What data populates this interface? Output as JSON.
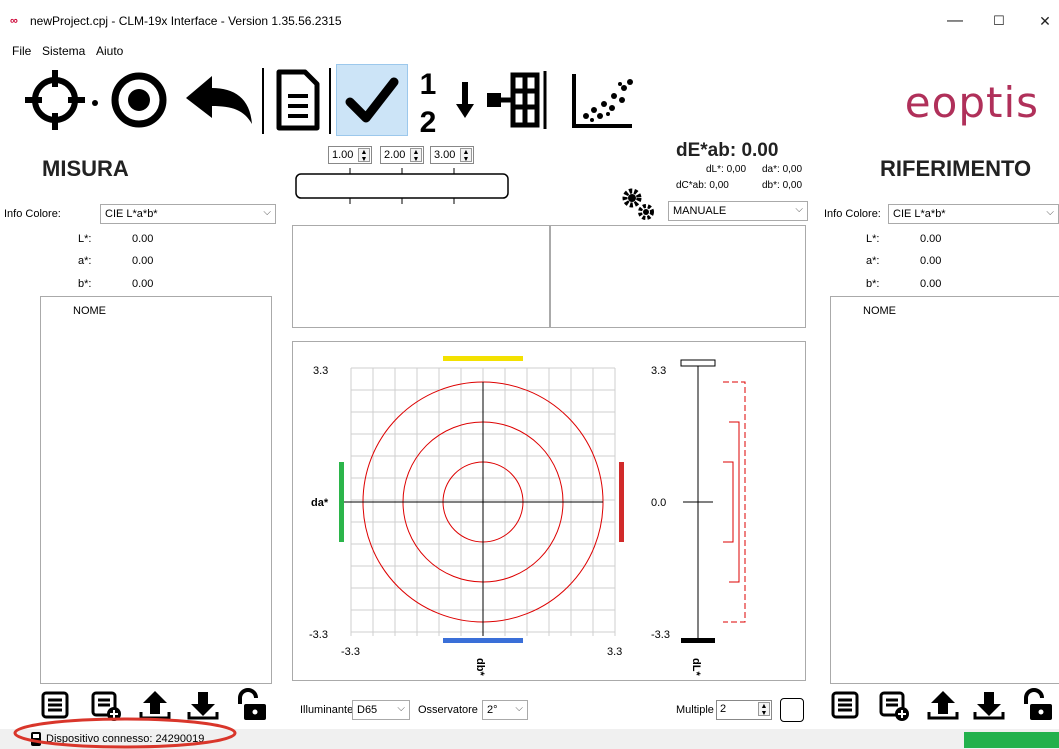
{
  "window": {
    "title": "newProject.cpj - CLM-19x Interface - Version 1.35.56.2315",
    "app_icon": "infinity-icon",
    "minimize": "—",
    "maximize": "☐",
    "close": "✕"
  },
  "menu": [
    "File",
    "Sistema",
    "Aiuto"
  ],
  "toolbar": {
    "tools": [
      "crosshair-icon",
      "target-icon",
      "undo-icon",
      "document-icon",
      "check-icon",
      "fraction-icon",
      "arrow-down-icon",
      "tree-icon",
      "scatter-icon"
    ],
    "active_tool": "check-icon"
  },
  "brand": {
    "logo": "eoptis",
    "color": "#b0305a"
  },
  "left": {
    "heading": "MISURA",
    "info_label": "Info Colore:",
    "info_value": "CIE L*a*b*",
    "L_label": "L*:",
    "L_value": "0.00",
    "a_label": "a*:",
    "a_value": "0.00",
    "b_label": "b*:",
    "b_value": "0.00",
    "list_header": "NOME"
  },
  "right": {
    "heading": "RIFERIMENTO",
    "info_label": "Info Colore:",
    "info_value": "CIE L*a*b*",
    "L_label": "L*:",
    "L_value": "0.00",
    "a_label": "a*:",
    "a_value": "0.00",
    "b_label": "b*:",
    "b_value": "0.00",
    "list_header": "NOME"
  },
  "center": {
    "spin1": "1.00",
    "spin2": "2.00",
    "spin3": "3.00",
    "dE_label": "dE*ab: 0.00",
    "dL": "dL*: 0,00",
    "da": "da*: 0,00",
    "dC": "dC*ab: 0,00",
    "db": "db*: 0,00",
    "mode": "MANUALE",
    "chart": {
      "a_top": "3.3",
      "a_bottom": "-3.3",
      "b_left": "-3.3",
      "b_right": "3.3",
      "da_label": "da*",
      "db_label": "db*",
      "l_top": "3.3",
      "l_mid": "0.0",
      "l_bottom": "-3.3",
      "dl_label": "dL*"
    },
    "illuminant_label": "Illuminante",
    "illuminant_value": "D65",
    "observer_label": "Osservatore",
    "observer_value": "2°",
    "multiple_label": "Multiple",
    "multiple_value": "2"
  },
  "status": {
    "text": "Dispositivo connesso: 24290019",
    "indicator_color": "#22b14c"
  }
}
